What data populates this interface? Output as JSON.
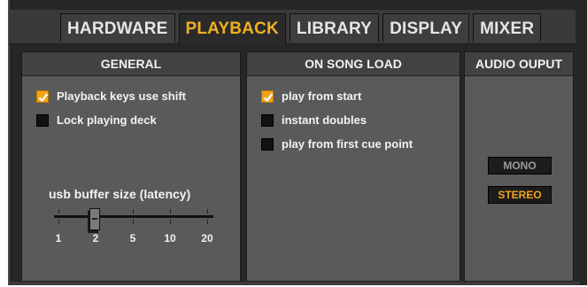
{
  "tabs": [
    {
      "label": "HARDWARE",
      "active": false
    },
    {
      "label": "PLAYBACK",
      "active": true
    },
    {
      "label": "LIBRARY",
      "active": false
    },
    {
      "label": "DISPLAY",
      "active": false
    },
    {
      "label": "MIXER",
      "active": false
    }
  ],
  "colors": {
    "accent": "#f0a418",
    "panel": "#5a5a5a",
    "header": "#424242",
    "background": "#262626"
  },
  "general": {
    "title": "GENERAL",
    "options": [
      {
        "label": "Playback keys use shift",
        "checked": true
      },
      {
        "label": "Lock playing deck",
        "checked": false
      }
    ],
    "slider": {
      "label": "usb buffer size (latency)",
      "ticks": [
        "1",
        "2",
        "5",
        "10",
        "20"
      ],
      "value": "2"
    }
  },
  "song_load": {
    "title": "ON SONG LOAD",
    "options": [
      {
        "label": "play from start",
        "checked": true
      },
      {
        "label": "instant doubles",
        "checked": false
      },
      {
        "label": "play from first cue point",
        "checked": false
      }
    ]
  },
  "audio_output": {
    "title": "AUDIO OUPUT",
    "mono_label": "MONO",
    "stereo_label": "STEREO",
    "selected": "STEREO"
  }
}
